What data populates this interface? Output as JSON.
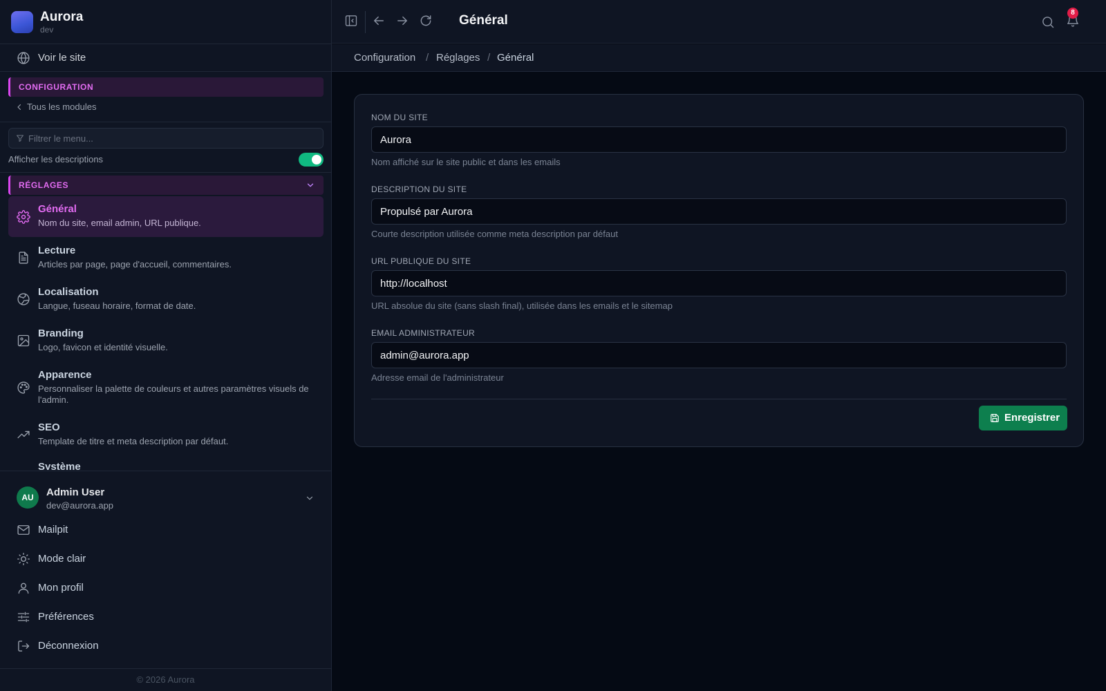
{
  "app": {
    "name": "Aurora",
    "env": "dev"
  },
  "sidebar": {
    "view_site": "Voir le site",
    "section_label": "CONFIGURATION",
    "back_label": "Tous les modules",
    "filter_placeholder": "Filtrer le menu...",
    "show_descriptions_label": "Afficher les descriptions",
    "show_descriptions": true,
    "group_label": "RÉGLAGES",
    "items": [
      {
        "title": "Général",
        "desc": "Nom du site, email admin, URL publique.",
        "icon": "gear-icon",
        "active": true
      },
      {
        "title": "Lecture",
        "desc": "Articles par page, page d'accueil, commentaires.",
        "icon": "document-icon",
        "active": false
      },
      {
        "title": "Localisation",
        "desc": "Langue, fuseau horaire, format de date.",
        "icon": "globe-icon",
        "active": false
      },
      {
        "title": "Branding",
        "desc": "Logo, favicon et identité visuelle.",
        "icon": "image-icon",
        "active": false
      },
      {
        "title": "Apparence",
        "desc": "Personnaliser la palette de couleurs et autres paramètres visuels de l'admin.",
        "icon": "palette-icon",
        "active": false
      },
      {
        "title": "SEO",
        "desc": "Template de titre et meta description par défaut.",
        "icon": "trending-up-icon",
        "active": false
      },
      {
        "title": "Système",
        "desc": "",
        "icon": "",
        "active": false
      }
    ],
    "user": {
      "initials": "AU",
      "name": "Admin User",
      "email": "dev@aurora.app"
    },
    "bottom_items": [
      {
        "label": "Mailpit",
        "icon": "mail-icon"
      },
      {
        "label": "Mode clair",
        "icon": "sun-icon"
      },
      {
        "label": "Mon profil",
        "icon": "user-icon"
      },
      {
        "label": "Préférences",
        "icon": "sliders-icon"
      },
      {
        "label": "Déconnexion",
        "icon": "logout-icon"
      }
    ],
    "copyright": "© 2026 Aurora"
  },
  "topbar": {
    "title": "Général",
    "notifications_count": "8"
  },
  "breadcrumb": [
    "Configuration",
    "Réglages",
    "Général"
  ],
  "form": {
    "fields": [
      {
        "label": "NOM DU SITE",
        "value": "Aurora",
        "help": "Nom affiché sur le site public et dans les emails"
      },
      {
        "label": "DESCRIPTION DU SITE",
        "value": "Propulsé par Aurora",
        "help": "Courte description utilisée comme meta description par défaut"
      },
      {
        "label": "URL PUBLIQUE DU SITE",
        "value": "http://localhost",
        "help": "URL absolue du site (sans slash final), utilisée dans les emails et le sitemap"
      },
      {
        "label": "EMAIL ADMINISTRATEUR",
        "value": "admin@aurora.app",
        "help": "Adresse email de l'administrateur"
      }
    ],
    "save_label": "Enregistrer"
  },
  "colors": {
    "accent": "#d946ef",
    "success": "#10b981",
    "save_button": "#0d7f4e",
    "badge": "#e11d48"
  }
}
